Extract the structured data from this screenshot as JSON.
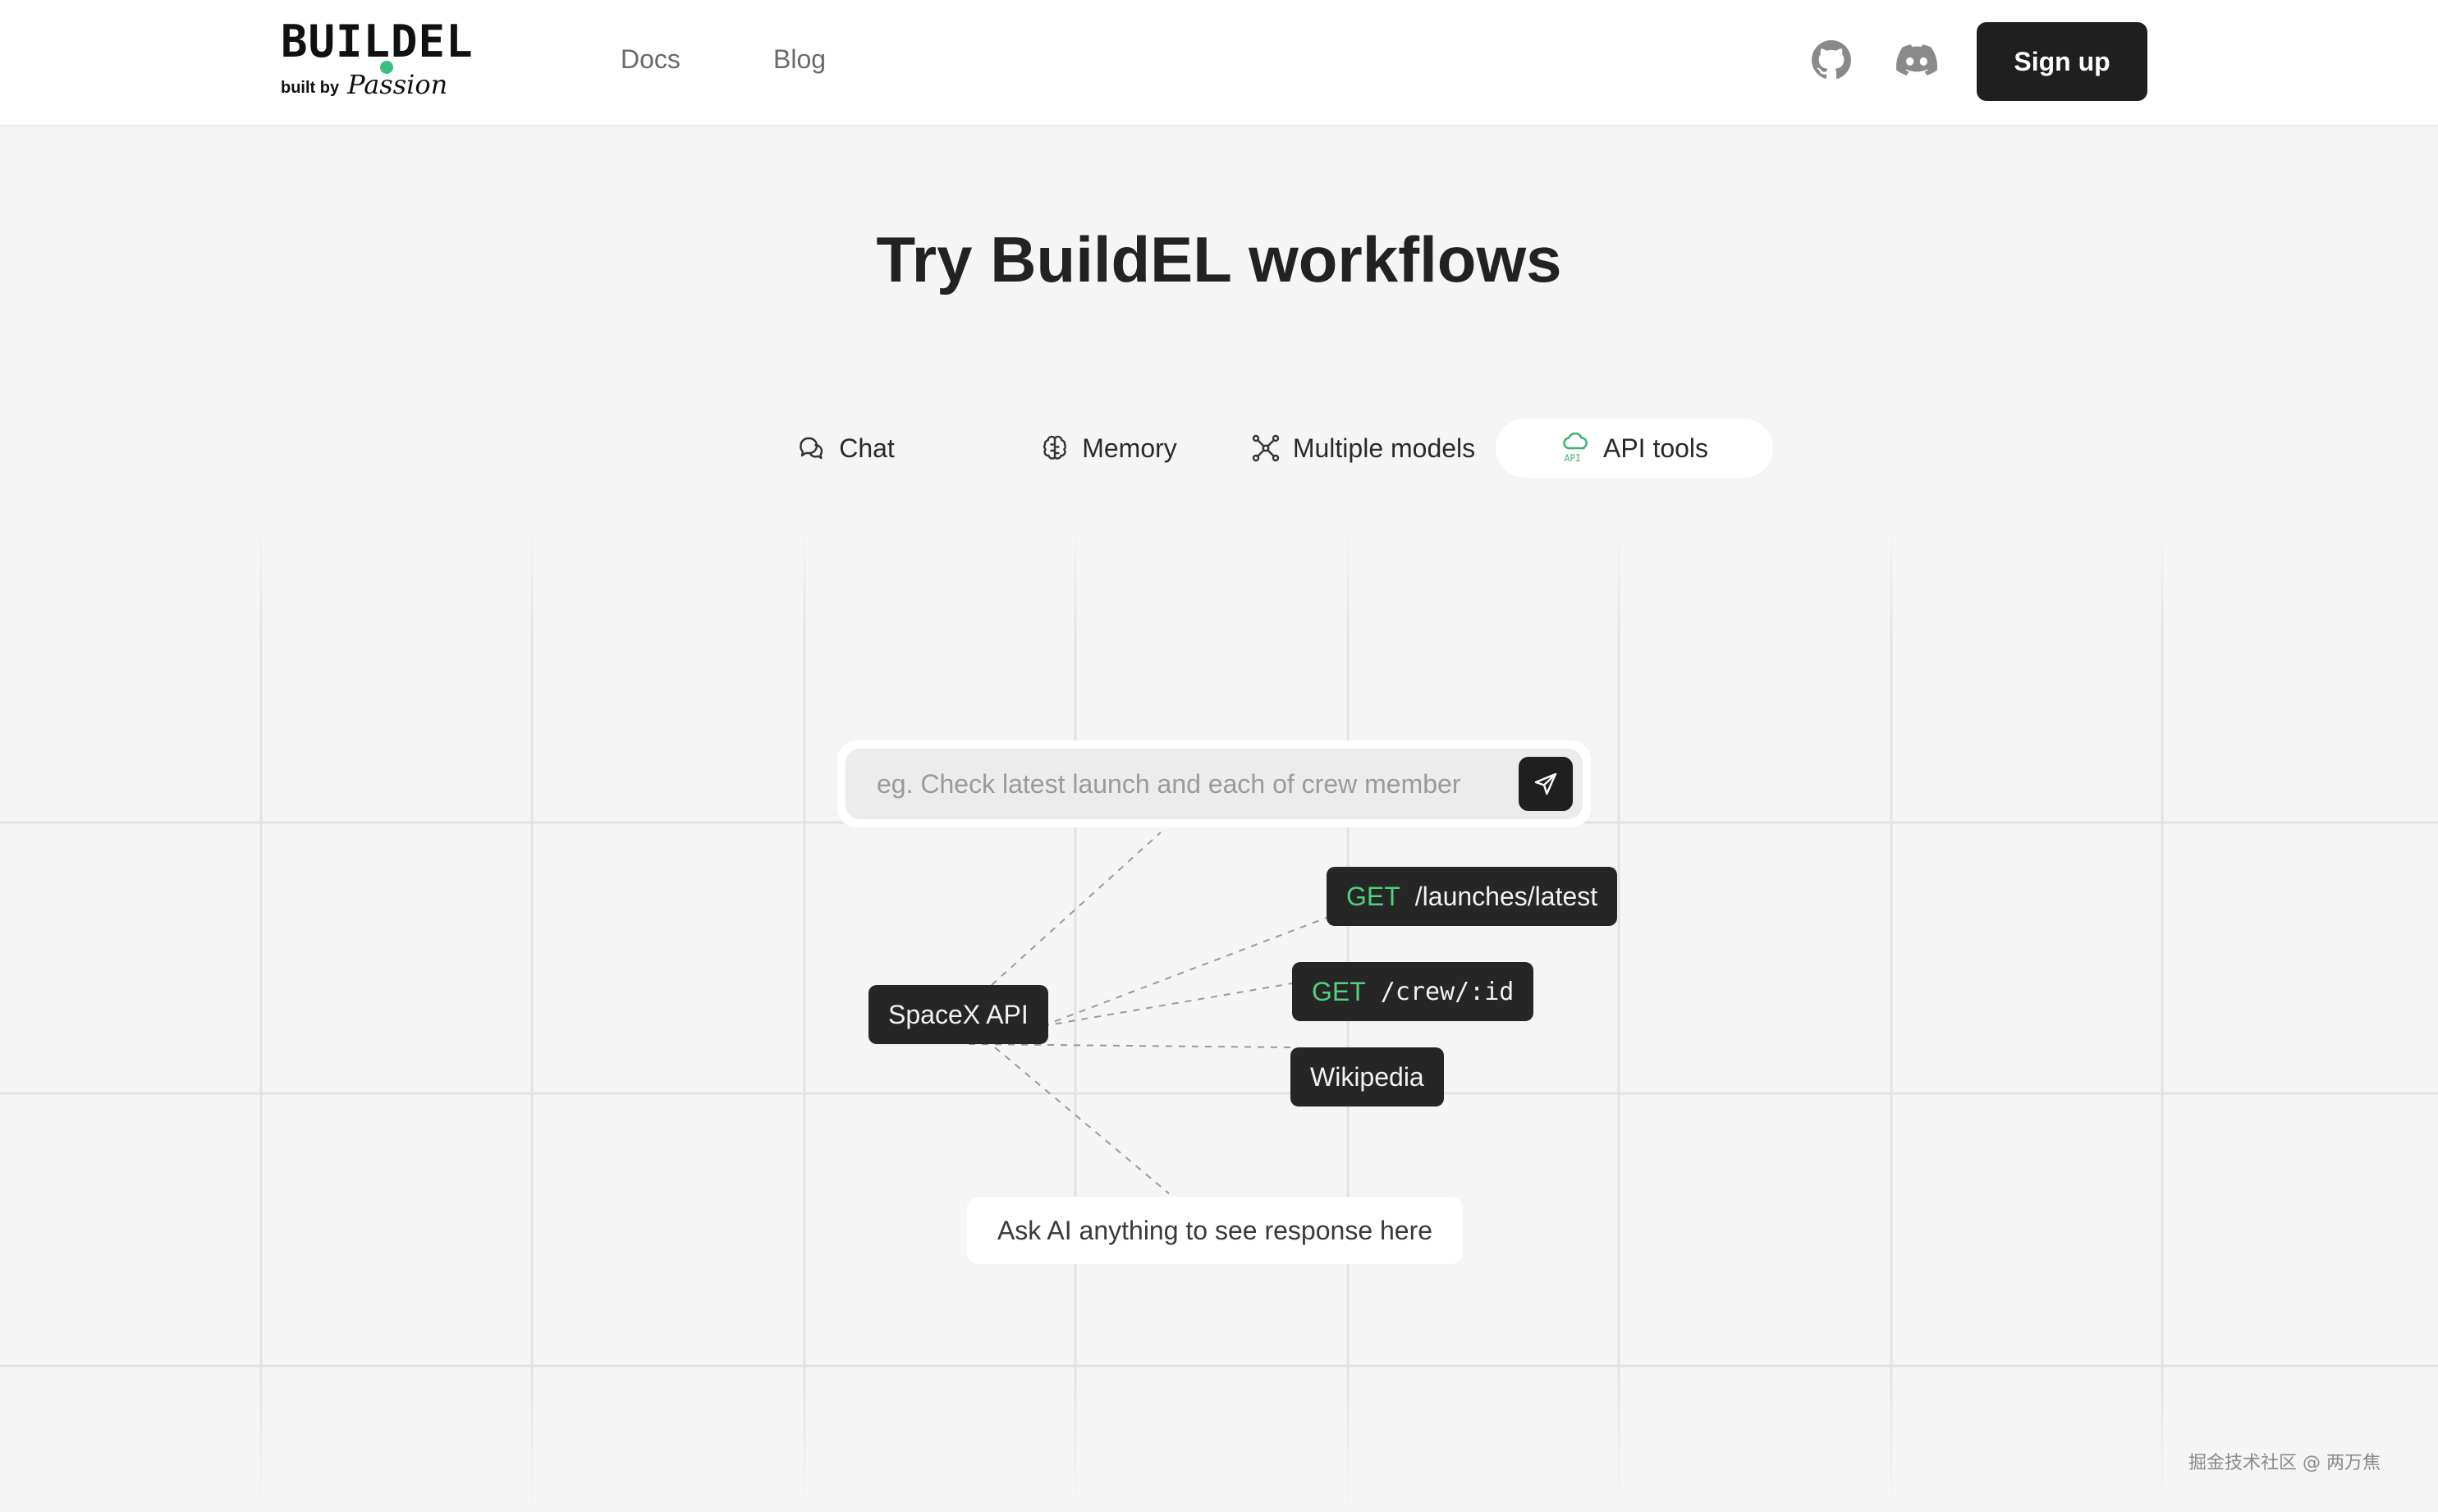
{
  "header": {
    "brand": "BUILDEL",
    "brand_sub_prefix": "built by",
    "brand_sub_name": "Passion",
    "nav": [
      {
        "label": "Docs"
      },
      {
        "label": "Blog"
      }
    ],
    "icons": [
      "github-icon",
      "discord-icon"
    ],
    "signup_label": "Sign up"
  },
  "title": "Try BuildEL workflows",
  "tabs": [
    {
      "label": "Chat",
      "icon": "chat-bubbles-icon"
    },
    {
      "label": "Memory",
      "icon": "brain-icon"
    },
    {
      "label": "Multiple models",
      "icon": "network-icon"
    },
    {
      "label": "API tools",
      "icon": "api-cloud-icon",
      "active": true
    }
  ],
  "prompt": {
    "placeholder": "eg. Check latest launch and each of crew member"
  },
  "nodes": {
    "spacex": "SpaceX API",
    "launches": {
      "method": "GET",
      "path": "/launches/latest"
    },
    "crew": {
      "method": "GET",
      "path": "/crew/:id"
    },
    "wiki": "Wikipedia"
  },
  "response_placeholder": "Ask AI anything to see response here",
  "watermark": "掘金技术社区 @ 两万焦",
  "colors": {
    "background": "#f5f5f5",
    "dark": "#1f1f1f",
    "accent_green": "#4fd17f",
    "grid_line": "#e2e2e2"
  }
}
